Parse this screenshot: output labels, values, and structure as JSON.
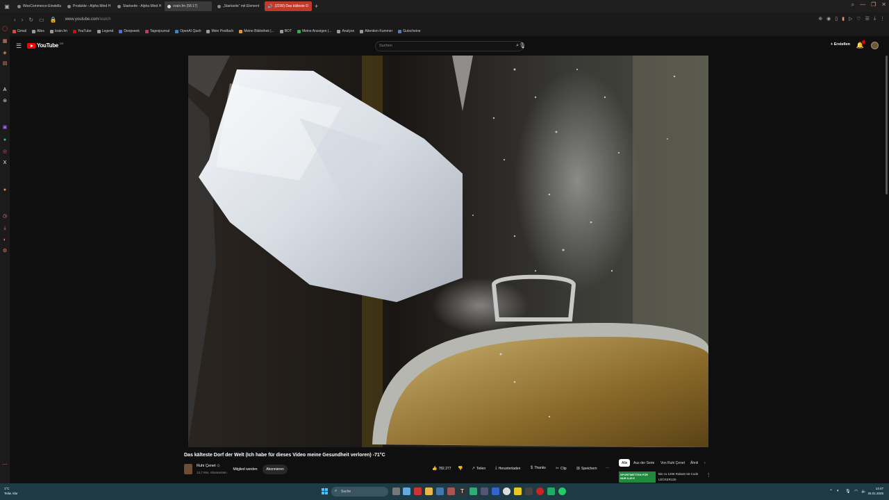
{
  "browser": {
    "tabs": [
      {
        "label": "WooCommerce-Einstellu",
        "state": "normal"
      },
      {
        "label": "Produkte ‹ Alpha Mind H",
        "state": "normal"
      },
      {
        "label": "Startseite - Alpha Mind H",
        "state": "normal"
      },
      {
        "label": "orain.fm (58:17)",
        "state": "active"
      },
      {
        "label": "„Startseite“ mit Element",
        "state": "normal"
      },
      {
        "label": "(2230) Das kälteste D",
        "state": "accent"
      }
    ],
    "url_host": "www.youtube.com",
    "url_path": "/watch",
    "bookmarks": [
      "Gmail",
      "Alles",
      "brain.fm",
      "YouTube",
      "Legend",
      "Deepseek",
      "Tagesjournal",
      "OpenAI Qash",
      "Mein Postfach",
      "Meine Bibliothek |...",
      "BOT",
      "Meine Anzeigen |...",
      "Analyze",
      "Attention Kummer",
      "Gutscheine"
    ]
  },
  "youtube": {
    "logo_text": "YouTube",
    "country_code": "DE",
    "search_placeholder": "Suchen",
    "create_label": "Erstellen"
  },
  "video": {
    "title": "Das kälteste Dorf der Welt (Ich habe für dieses Video meine Gesundheit verloren) -71°C",
    "channel_name": "Ruhi Çenet",
    "channel_verified": "⊙",
    "channel_subs": "14,7 Mio. Abonnenten",
    "member_label": "Mitglied werden",
    "subscribe_label": "Abonnieren",
    "likes": "782.277",
    "share_label": "Teilen",
    "download_label": "Herunterladen",
    "thanks_label": "Thanks",
    "clip_label": "Clip",
    "save_label": "Speichern",
    "more_label": "···"
  },
  "chips": [
    "Alle",
    "Aus der Serie",
    "Von Ruhi Çenet",
    "Ähnli"
  ],
  "ad": {
    "banner": "SPORTWETTEN FÜR NUR 0,49 €",
    "text": "Bis zu 120€ Rabatt mit Code LECKER120"
  },
  "taskbar": {
    "weather_temp": "1°C",
    "weather_desc": "Teilw. klar",
    "search_label": "Suche",
    "time": "14:47",
    "date": "26.01.2025"
  },
  "colors": {
    "accent_tab": "#c0392b",
    "youtube_red": "#ff0000",
    "taskbar": "#1e3a44"
  }
}
